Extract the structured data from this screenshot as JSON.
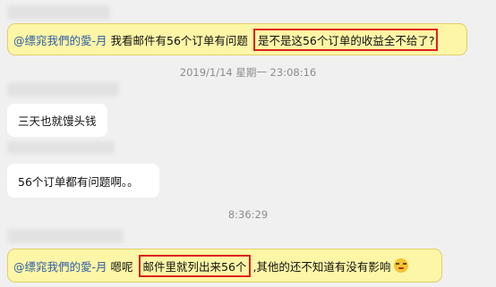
{
  "messages": [
    {
      "mention": "@缥窕我們的愛-月",
      "text": "我看邮件有56个订单有问题",
      "highlight": "是不是这56个订单的收益全不给了",
      "highlight_tail": "?"
    },
    {
      "text": "三天也就馒头钱"
    },
    {
      "text": "56个订单都有问题啊。。"
    },
    {
      "mention": "@缥窕我們的愛-月",
      "text_before": "嗯呢",
      "highlight": "邮件里就列出来56个",
      "text_after": ",其他的还不知道有没有影响"
    }
  ],
  "timestamps": [
    "2019/1/14 星期一 23:08:16",
    "8:36:29"
  ],
  "icons": {
    "emoji": "awkward-emoji-icon"
  },
  "colors": {
    "mention": "#2f5ea8",
    "highlight_box": "#e0211c",
    "bubble_yellow": "#fdf6a6",
    "background": "#f0f0f0"
  }
}
